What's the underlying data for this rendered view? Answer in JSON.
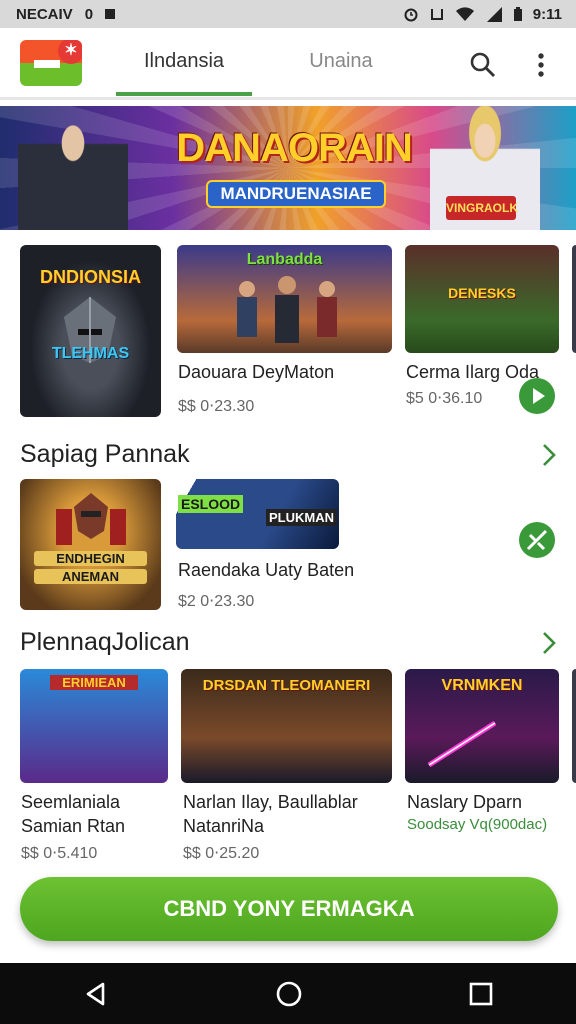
{
  "status_bar": {
    "carrier": "NECAIV",
    "carrier_mark": "0",
    "time": "9:11",
    "icons": [
      "alarm-icon",
      "nfc-icon",
      "wifi-icon",
      "signal-icon",
      "battery-icon"
    ]
  },
  "app_bar": {
    "logo_icon": "app-logo-icon",
    "tabs": [
      {
        "label": "Ilndansia"
      },
      {
        "label": "Unaina"
      }
    ],
    "active_tab_color": "#4aa14a"
  },
  "banner": {
    "title": "DANAORAIN",
    "subtitle": "MANDRUENASIAE",
    "tag": "VINGRAOLK"
  },
  "row1": {
    "items": [
      {
        "thumb_top": "DNDIONSIA",
        "thumb_bottom": "TLEHMAS",
        "title": "",
        "price": ""
      },
      {
        "thumb_top": "Lanbadda",
        "title": "Daouara DeyMaton",
        "price": "$$ 0⋅23.30"
      },
      {
        "thumb_top": "DENESKS",
        "title": "Cerma Ilarg Oda",
        "price": "$5 0⋅36.10"
      }
    ]
  },
  "section1": {
    "title": "Sapiag Pannak",
    "items": [
      {
        "thumb_top": "ENDHEGIN",
        "thumb_bottom": "ANEMAN",
        "title": "",
        "price": ""
      },
      {
        "thumb_top": "ESLOOD",
        "thumb_bottom": "PLUKMAN",
        "title": "Raendaka Uaty Baten",
        "price": "$2 0⋅23.30"
      }
    ]
  },
  "section2": {
    "title": "PlennaqJolican",
    "items": [
      {
        "thumb_top": "ERIMIEAN",
        "title_line1": "Seemlaniala",
        "title_line2": "Samian Rtan",
        "price": "$$ 0⋅5.410"
      },
      {
        "thumb_top": "DRSDAN TLEOMANERI",
        "title_line1": "Narlan Ilay, Baullablar",
        "title_line2": "NatanriNa",
        "price": "$$ 0⋅25.20"
      },
      {
        "thumb_top": "VRNMKEN",
        "title_line1": "Naslary Dparn",
        "title_line2": "Soodsay Vq(900dac)",
        "price": ""
      }
    ]
  },
  "cta": {
    "label": "CBND YONY ERMAGKA"
  },
  "nav": {
    "back_icon": "back-icon",
    "home_icon": "home-icon",
    "recents_icon": "recents-icon"
  },
  "colors": {
    "accent": "#4aa14a",
    "cta": "#5ab425",
    "nav_bg": "#0c0c0c"
  }
}
